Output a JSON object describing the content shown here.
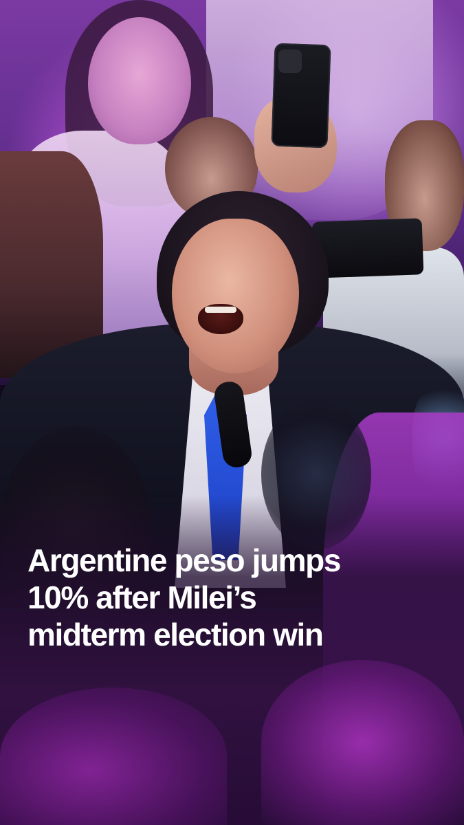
{
  "headline": {
    "lines": [
      "Argentine peso jumps",
      "10% after Milei’s",
      "midterm election win"
    ]
  },
  "colors": {
    "headline_text": "#ffffff",
    "accent_purple": "#9b3cc4",
    "tie_blue": "#2f5ee8"
  }
}
